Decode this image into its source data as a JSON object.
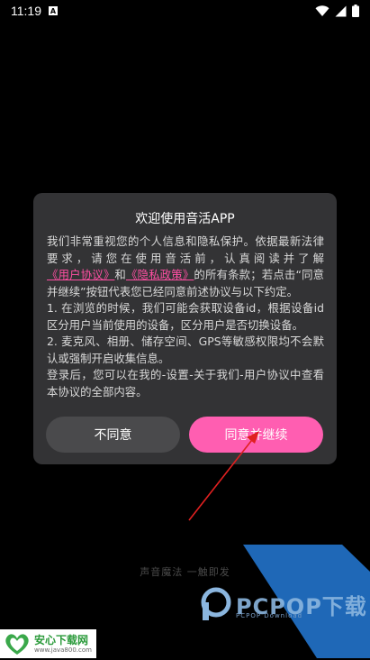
{
  "status_bar": {
    "time": "11:19",
    "notification_icon": "a-square-icon",
    "icons": [
      "wifi-icon",
      "signal-icon",
      "battery-icon"
    ]
  },
  "dialog": {
    "title": "欢迎使用音活APP",
    "intro_before_link": "我们非常重视您的个人信息和隐私保护。依据最新法律要求，请您在使用音活前，认真阅读并了解",
    "user_agreement_link": "《用户协议》",
    "and_text": "和",
    "privacy_policy_link": "《隐私政策》",
    "intro_after_link": "的所有条款；若点击“同意并继续”按钮代表您已经同意前述协议与以下约定。",
    "item_1": "1. 在浏览的时候，我们可能会获取设备id，根据设备id区分用户当前使用的设备，区分用户是否切换设备。",
    "item_2": "2. 麦克风、相册、储存空间、GPS等敏感权限均不会默认或强制开启收集信息。",
    "footer_note": "登录后，您可以在我的-设置-关于我们-用户协议中查看本协议的全部内容。",
    "disagree_label": "不同意",
    "agree_label": "同意并继续"
  },
  "tagline": "声音魔法 一触即发",
  "watermarks": {
    "pcpop_text": "PCPOP下载",
    "pcpop_sub": "PCPOP Download",
    "anxin_title": "安心下载网",
    "anxin_url": "www.java800.com"
  },
  "colors": {
    "background": "#000000",
    "dialog_bg": "#333335",
    "link": "#ff4fa3",
    "agree_button": "#ff5eb1",
    "disagree_button": "#4a4a4c",
    "annotation_arrow": "#e02020"
  }
}
